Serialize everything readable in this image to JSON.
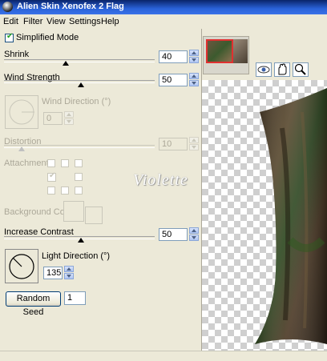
{
  "window": {
    "title": "Alien Skin Xenofex 2 Flag"
  },
  "menu": [
    "Edit",
    "Filter",
    "View",
    "Settings",
    "Help"
  ],
  "simplified_mode": {
    "label": "Simplified Mode",
    "checked": true
  },
  "shrink": {
    "label": "Shrink",
    "value": "40"
  },
  "wind_strength": {
    "label": "Wind Strength",
    "value": "50"
  },
  "wind_direction": {
    "label": "Wind Direction (°)",
    "value": "0"
  },
  "distortion": {
    "label": "Distortion",
    "value": "10"
  },
  "attachments": {
    "label": "Attachments"
  },
  "watermark": "Violette",
  "background_color": {
    "label": "Background Color"
  },
  "increase_contrast": {
    "label": "Increase Contrast",
    "value": "50"
  },
  "light_direction": {
    "label": "Light Direction (°)",
    "value": "135"
  },
  "random_seed": {
    "button_label": "Random Seed",
    "value": "1"
  },
  "toolbar_icons": [
    "eye-icon",
    "hand-icon",
    "zoom-icon"
  ],
  "colors": {
    "titlebar": "#0a246a",
    "panel": "#ece9d8",
    "accent_red": "#e03030"
  }
}
